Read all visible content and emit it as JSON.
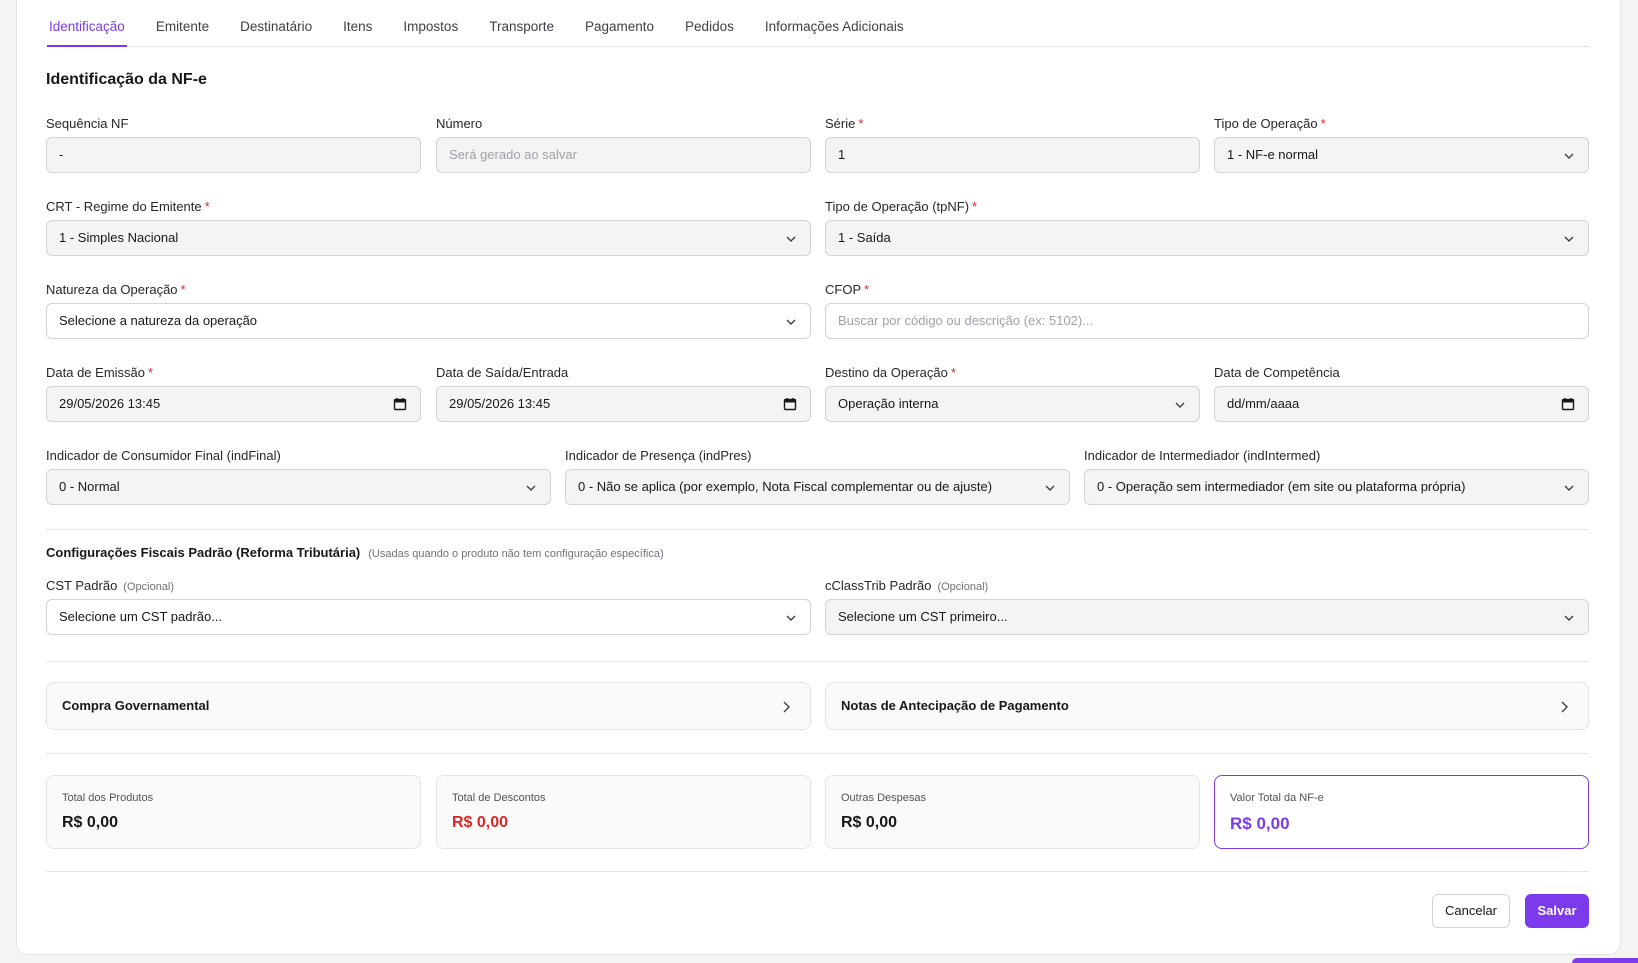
{
  "tabs": [
    "Identificação",
    "Emitente",
    "Destinatário",
    "Itens",
    "Impostos",
    "Transporte",
    "Pagamento",
    "Pedidos",
    "Informações Adicionais"
  ],
  "active_tab": "Identificação",
  "section_title": "Identificação da NF-e",
  "fields": {
    "sequencia": {
      "label": "Sequência NF",
      "value": "-"
    },
    "numero": {
      "label": "Número",
      "placeholder": "Será gerado ao salvar"
    },
    "serie": {
      "label": "Série",
      "value": "1"
    },
    "tipo_operacao": {
      "label": "Tipo de Operação",
      "value": "1 - NF-e normal"
    },
    "crt": {
      "label": "CRT - Regime do Emitente",
      "value": "1 - Simples Nacional"
    },
    "tpnf": {
      "label": "Tipo de Operação (tpNF)",
      "value": "1 - Saída"
    },
    "natureza": {
      "label": "Natureza da Operação",
      "value": "Selecione a natureza da operação"
    },
    "cfop": {
      "label": "CFOP",
      "placeholder": "Buscar por código ou descrição (ex: 5102)..."
    },
    "data_emissao": {
      "label": "Data de Emissão",
      "value": "29/05/2026 13:45"
    },
    "data_saida": {
      "label": "Data de Saída/Entrada",
      "value": "29/05/2026 13:45"
    },
    "destino": {
      "label": "Destino da Operação",
      "value": "Operação interna"
    },
    "data_competencia": {
      "label": "Data de Competência",
      "value": "dd/mm/aaaa"
    },
    "ind_final": {
      "label": "Indicador de Consumidor Final (indFinal)",
      "value": "0 - Normal"
    },
    "ind_pres": {
      "label": "Indicador de Presença (indPres)",
      "value": "0 - Não se aplica (por exemplo, Nota Fiscal complementar ou de ajuste)"
    },
    "ind_intermed": {
      "label": "Indicador de Intermediador (indIntermed)",
      "value": "0 - Operação sem intermediador (em site ou plataforma própria)"
    }
  },
  "fiscal": {
    "title": "Configurações Fiscais Padrão (Reforma Tributária)",
    "note": "(Usadas quando o produto não tem configuração específica)",
    "cst": {
      "label": "CST Padrão",
      "optional": "(Opcional)",
      "value": "Selecione um CST padrão..."
    },
    "cclasstrib": {
      "label": "cClassTrib Padrão",
      "optional": "(Opcional)",
      "value": "Selecione um CST primeiro..."
    }
  },
  "collapsibles": {
    "compra_gov": "Compra Governamental",
    "antecipacao": "Notas de Antecipação de Pagamento"
  },
  "totals": {
    "produtos": {
      "label": "Total dos Produtos",
      "value": "R$ 0,00"
    },
    "descontos": {
      "label": "Total de Descontos",
      "value": "R$ 0,00"
    },
    "despesas": {
      "label": "Outras Despesas",
      "value": "R$ 0,00"
    },
    "total_nfe": {
      "label": "Valor Total da NF-e",
      "value": "R$ 0,00"
    }
  },
  "actions": {
    "cancel": "Cancelar",
    "save": "Salvar"
  },
  "colors": {
    "accent": "#7c3aed",
    "danger": "#dc2626",
    "border": "#d4d4d8"
  }
}
